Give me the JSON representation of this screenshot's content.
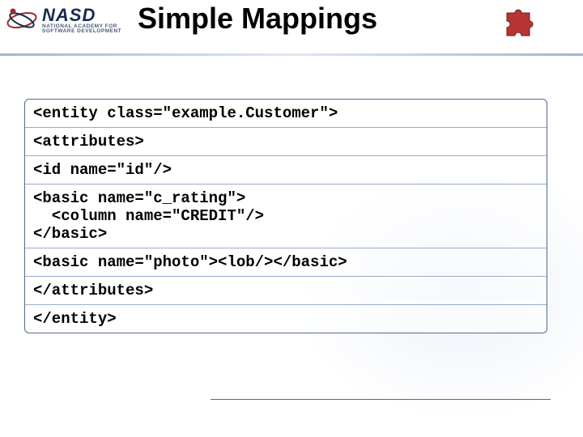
{
  "header": {
    "logo_name": "NASD",
    "logo_sub": "NATIONAL ACADEMY FOR\nSOFTWARE DEVELOPMENT",
    "title": "Simple Mappings"
  },
  "code": {
    "l1": "<entity class=\"example.Customer\">",
    "l2": "<attributes>",
    "l3": "<id name=\"id\"/>",
    "l4": "<basic name=\"c_rating\">\n  <column name=\"CREDIT\"/>\n</basic>",
    "l5": "<basic name=\"photo\"><lob/></basic>",
    "l6": "</attributes>",
    "l7": "</entity>"
  }
}
